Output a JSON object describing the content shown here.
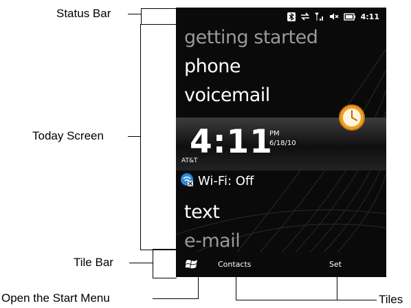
{
  "callouts": {
    "status_bar": "Status Bar",
    "today_screen": "Today Screen",
    "tile_bar": "Tile Bar",
    "open_start_menu": "Open the Start Menu",
    "tiles": "Tiles"
  },
  "status_bar": {
    "icons": [
      "bluetooth-icon",
      "data-transfer-icon",
      "signal-strength-icon",
      "speaker-muted-icon",
      "battery-charging-icon"
    ],
    "time": "4:11"
  },
  "today": {
    "menu_items": [
      {
        "label": "getting started",
        "state": "dim"
      },
      {
        "label": "phone",
        "state": "normal"
      },
      {
        "label": "voicemail",
        "state": "normal"
      },
      {
        "label": "text",
        "state": "normal"
      },
      {
        "label": "e-mail",
        "state": "dim"
      }
    ],
    "clock": {
      "time": "4:11",
      "ampm": "PM",
      "date": "6/18/10",
      "carrier": "AT&T",
      "icon": "analog-clock-icon"
    },
    "wifi": {
      "label": "Wi-Fi: Off",
      "icon": "wifi-off-icon"
    }
  },
  "tile_bar": {
    "start_icon": "windows-logo-icon",
    "tiles": [
      "Contacts",
      "Set"
    ]
  },
  "colors": {
    "accent_clock": "#f0a020",
    "wifi_icon": "#2a8ad8"
  }
}
